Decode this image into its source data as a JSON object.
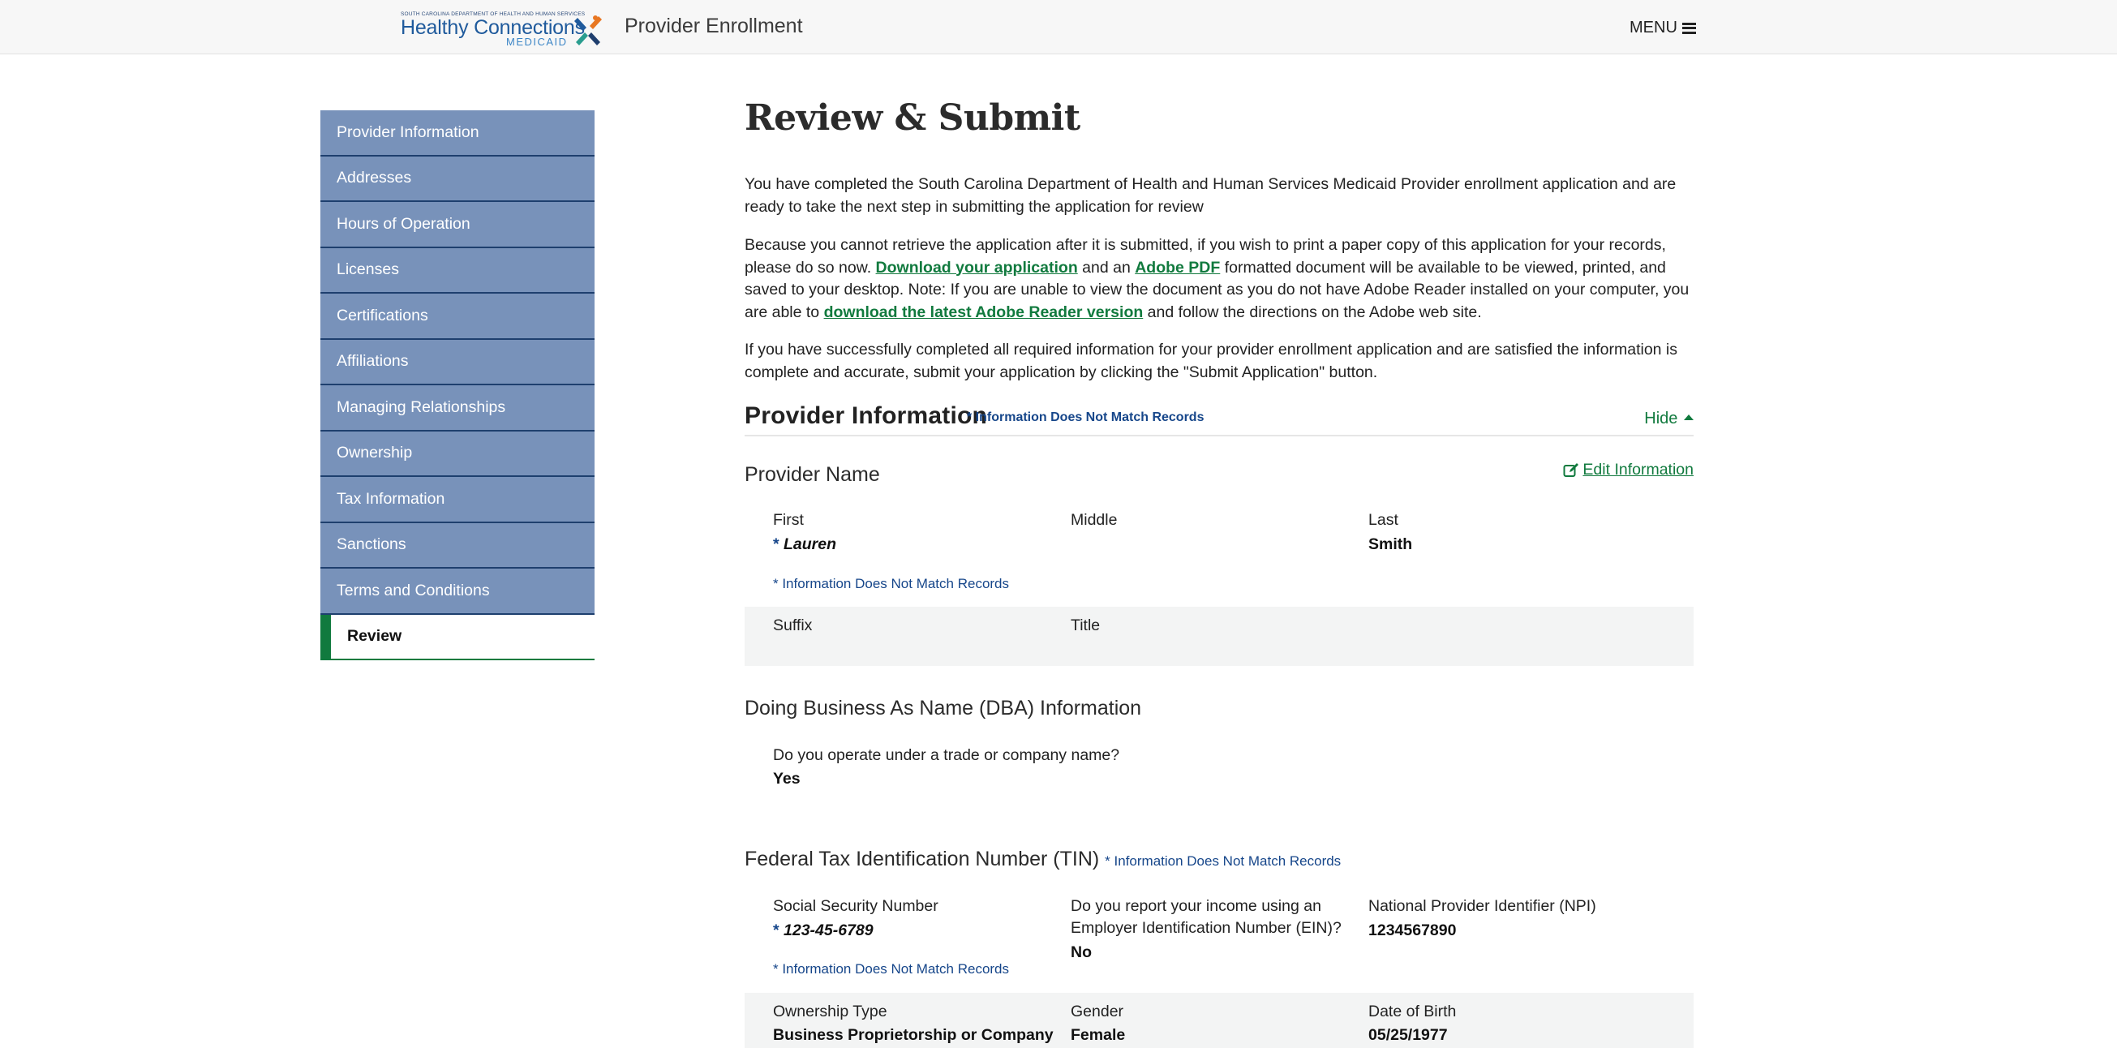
{
  "header": {
    "logo_small": "SOUTH CAROLINA DEPARTMENT OF HEALTH AND HUMAN SERVICES",
    "logo_main": "Healthy Connections",
    "logo_sub": "MEDICAID",
    "app_title": "Provider Enrollment",
    "menu_label": "MENU",
    "menu_icon": "hamburger-icon"
  },
  "sidebar": {
    "items": [
      {
        "label": "Provider Information"
      },
      {
        "label": "Addresses"
      },
      {
        "label": "Hours of Operation"
      },
      {
        "label": "Licenses"
      },
      {
        "label": "Certifications"
      },
      {
        "label": "Affiliations"
      },
      {
        "label": "Managing Relationships"
      },
      {
        "label": "Ownership"
      },
      {
        "label": "Tax Information"
      },
      {
        "label": "Sanctions"
      },
      {
        "label": "Terms and Conditions"
      },
      {
        "label": "Review",
        "active": true
      }
    ]
  },
  "main": {
    "title": "Review & Submit",
    "p1": "You have completed the South Carolina Department of Health and Human Services Medicaid Provider enrollment application and are ready to take the next step in submitting the application for review",
    "p2": {
      "a": "Because you cannot retrieve the application after it is submitted, if you wish to print a paper copy of this application for your records, please do so now. ",
      "link1": "Download your application",
      "b": " and an ",
      "link2": "Adobe PDF",
      "c": " formatted document will be available to be viewed, printed, and saved to your desktop. Note: If you are unable to view the document as you do not have Adobe Reader installed on your computer, you are able to ",
      "link3": "download the latest Adobe Reader version",
      "d": " and follow the directions on the Adobe web site."
    },
    "p3": "If you have successfully completed all required information for your provider enrollment application and are satisfied the information is complete and accurate, submit your application by clicking the \"Submit Application\" button.",
    "section": {
      "title": "Provider Information",
      "mismatch": "* Information Does Not Match Records",
      "hide_label": "Hide"
    },
    "provider_name": {
      "title": "Provider Name",
      "edit_label": " Edit Information",
      "first_label": "First",
      "first_value": "Lauren",
      "middle_label": "Middle",
      "last_label": "Last",
      "last_value": "Smith",
      "mismatch": "* Information Does Not Match Records",
      "suffix_label": "Suffix",
      "title_label": "Title"
    },
    "dba": {
      "title": "Doing Business As Name (DBA) Information",
      "question": "Do you operate under a trade or company name?",
      "answer": "Yes"
    },
    "tin": {
      "title": "Federal Tax Identification Number (TIN)",
      "mismatch_inline": "* Information Does Not Match Records",
      "ssn_label": "Social Security Number",
      "ssn_value": "123-45-6789",
      "ein_label_1": "Do you report your income using an",
      "ein_label_2": "Employer Identification Number (EIN)?",
      "ein_value": "No",
      "npi_label": "National Provider Identifier (NPI)",
      "npi_value": "1234567890",
      "mismatch": "* Information Does Not Match Records",
      "ownership_label": "Ownership Type",
      "ownership_value": "Business Proprietorship or Company",
      "gender_label": "Gender",
      "gender_value": "Female",
      "dob_label": "Date of Birth",
      "dob_value": "05/25/1977"
    }
  },
  "colors": {
    "sidebar_bg": "#7892ba",
    "sidebar_border": "#1e3f6e",
    "active_accent": "#117a3e",
    "link_green": "#117a3e",
    "mismatch_blue": "#16468a",
    "header_bg": "#f7f7f7"
  }
}
